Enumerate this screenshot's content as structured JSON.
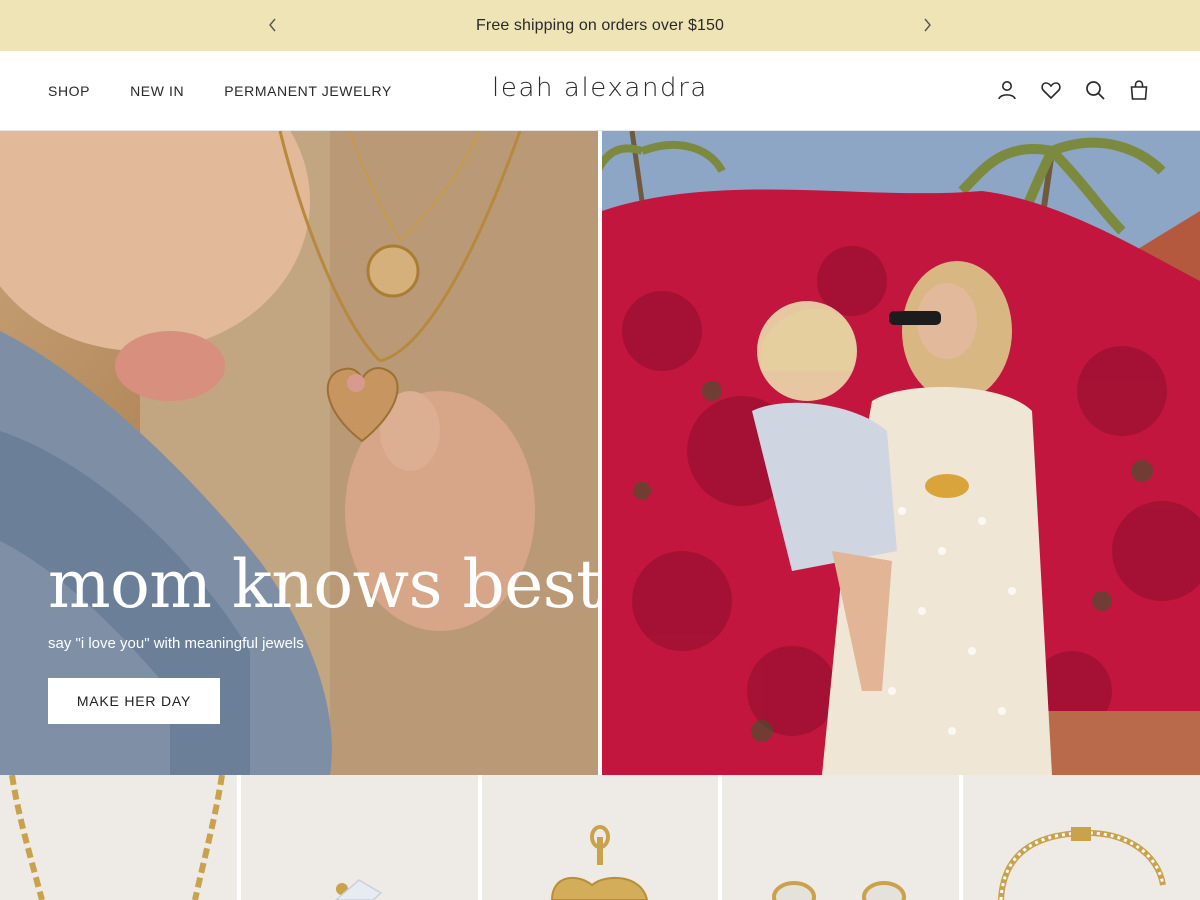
{
  "announcement": {
    "text": "Free shipping on orders over $150",
    "prev_icon": "chevron-left-icon",
    "next_icon": "chevron-right-icon"
  },
  "header": {
    "nav": [
      {
        "label": "SHOP"
      },
      {
        "label": "NEW IN"
      },
      {
        "label": "PERMANENT JEWELRY"
      }
    ],
    "logo": "leah alexandra",
    "icons": [
      "account-icon",
      "wishlist-heart-icon",
      "search-icon",
      "cart-bag-icon"
    ]
  },
  "hero": {
    "title": "mom knows best",
    "subtitle": "say \"i love you\" with meaningful jewels",
    "cta_label": "MAKE HER DAY"
  },
  "products": [
    {
      "name": "gold-chain-necklace"
    },
    {
      "name": "crystal-earring"
    },
    {
      "name": "gold-heart-pendant"
    },
    {
      "name": "pave-hoop-earrings"
    },
    {
      "name": "tennis-bracelet"
    }
  ],
  "colors": {
    "announcement_bg": "#efe4b6",
    "product_bg": "#eeebe6"
  }
}
